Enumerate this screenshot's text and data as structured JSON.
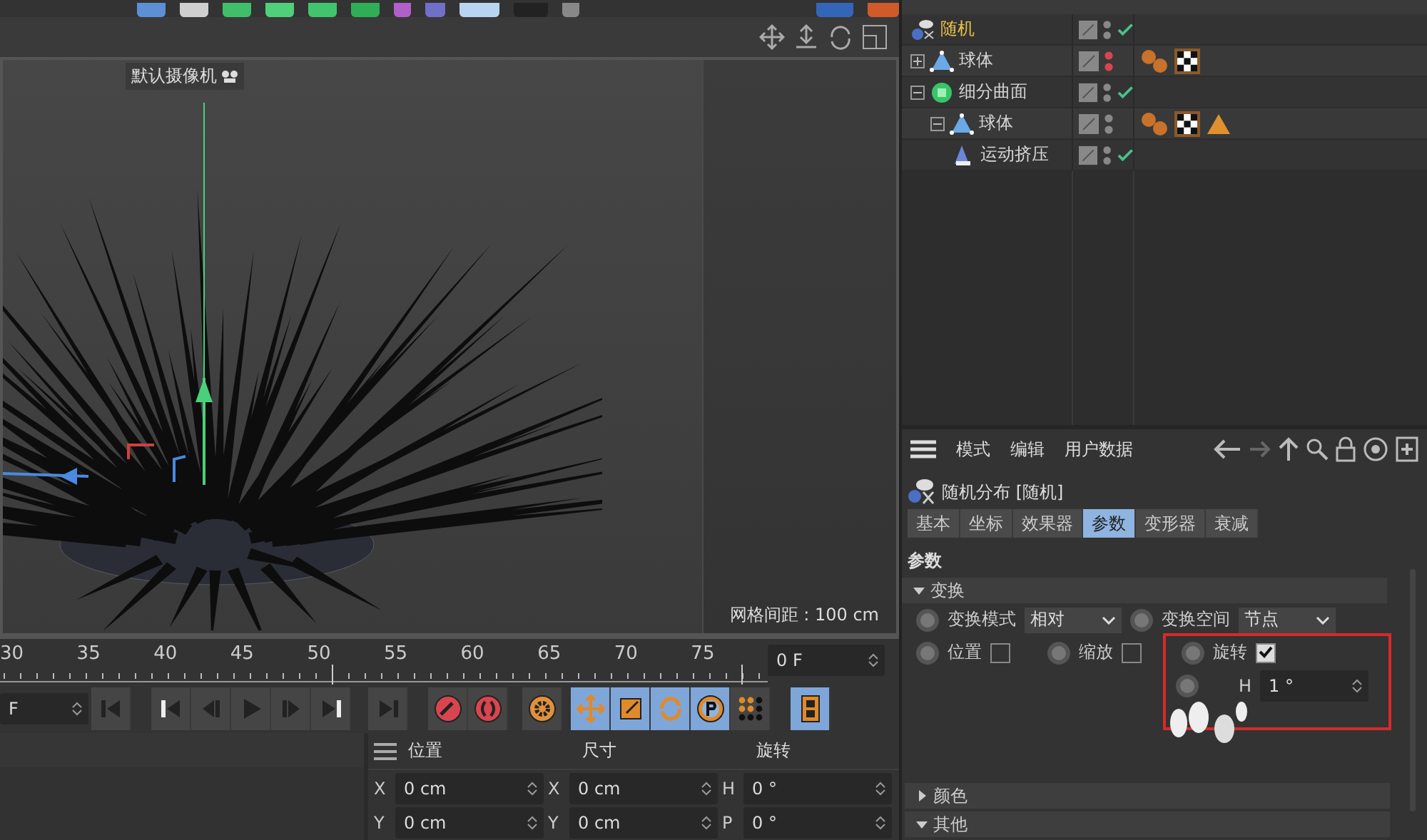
{
  "viewport": {
    "camera_label": "默认摄像机",
    "grid_spacing": "网格间距 : 100 cm"
  },
  "timeline": {
    "ticks": [
      "30",
      "35",
      "40",
      "45",
      "50",
      "55",
      "60",
      "65",
      "70",
      "75"
    ],
    "frame_field": "0 F",
    "start_field": "F"
  },
  "transport": [
    {
      "kind": "first",
      "selected": false
    },
    {
      "kind": "prev-key",
      "selected": false
    },
    {
      "kind": "prev-frame",
      "selected": false
    },
    {
      "kind": "play",
      "selected": false
    },
    {
      "kind": "next-frame",
      "selected": false
    },
    {
      "kind": "next-key",
      "selected": false
    },
    {
      "kind": "last",
      "selected": false
    },
    {
      "kind": "record",
      "selected": false
    },
    {
      "kind": "autokey",
      "selected": false
    },
    {
      "kind": "gear",
      "selected": false
    },
    {
      "kind": "move",
      "selected": true
    },
    {
      "kind": "scale",
      "selected": true
    },
    {
      "kind": "rotate",
      "selected": true
    },
    {
      "kind": "param",
      "selected": true
    },
    {
      "kind": "dots",
      "selected": false
    },
    {
      "kind": "film",
      "selected": true
    }
  ],
  "coordinates": {
    "columns": [
      "位置",
      "尺寸",
      "旋转"
    ],
    "rows": [
      [
        {
          "axis": "X",
          "value": "0 cm"
        },
        {
          "axis": "X",
          "value": "0 cm"
        },
        {
          "axis": "H",
          "value": "0 °"
        }
      ],
      [
        {
          "axis": "Y",
          "value": "0 cm"
        },
        {
          "axis": "Y",
          "value": "0 cm"
        },
        {
          "axis": "P",
          "value": "0 °"
        }
      ]
    ]
  },
  "objects": [
    {
      "name": "随机",
      "kind": "cloner",
      "selected": true,
      "hidden": false,
      "enabled": true
    },
    {
      "name": "球体",
      "kind": "sphere",
      "selected": false,
      "expanded": false,
      "hidden": true,
      "tags": [
        {
          "kind": "material"
        },
        {
          "kind": "checker"
        }
      ]
    },
    {
      "name": "细分曲面",
      "kind": "subdivision",
      "selected": false,
      "expanded": true,
      "hidden": false,
      "enabled": true,
      "children": [
        {
          "name": "球体",
          "kind": "sphere",
          "selected": false,
          "expanded": true,
          "hidden": false,
          "tags": [
            {
              "kind": "material"
            },
            {
              "kind": "checker"
            },
            {
              "kind": "triangle"
            }
          ],
          "children": [
            {
              "name": "运动挤压",
              "kind": "deformer",
              "selected": false,
              "hidden": false,
              "enabled": true
            }
          ]
        }
      ]
    }
  ],
  "attributes": {
    "menu": [
      "模式",
      "编辑",
      "用户数据"
    ],
    "title": "随机分布 [随机]",
    "tabs": [
      {
        "label": "基本",
        "selected": false
      },
      {
        "label": "坐标",
        "selected": false
      },
      {
        "label": "效果器",
        "selected": false
      },
      {
        "label": "参数",
        "selected": true
      },
      {
        "label": "变形器",
        "selected": false
      },
      {
        "label": "衰减",
        "selected": false
      }
    ],
    "heading": "参数",
    "transform": {
      "label": "变换",
      "expanded": true,
      "mode": {
        "label": "变换模式",
        "value": "相对",
        "keyframe": false
      },
      "space": {
        "label": "变换空间",
        "value": "节点",
        "keyframe": false
      },
      "toggles": [
        {
          "label": "位置",
          "checked": false,
          "keyframe": false
        },
        {
          "label": "缩放",
          "checked": false,
          "keyframe": false
        },
        {
          "label": "旋转",
          "checked": true,
          "keyframe": false
        }
      ],
      "rotation": {
        "label": "H",
        "value": "1 °",
        "keyframe": false
      }
    },
    "sections": [
      {
        "label": "颜色",
        "expanded": false
      },
      {
        "label": "其他",
        "expanded": true
      }
    ]
  }
}
